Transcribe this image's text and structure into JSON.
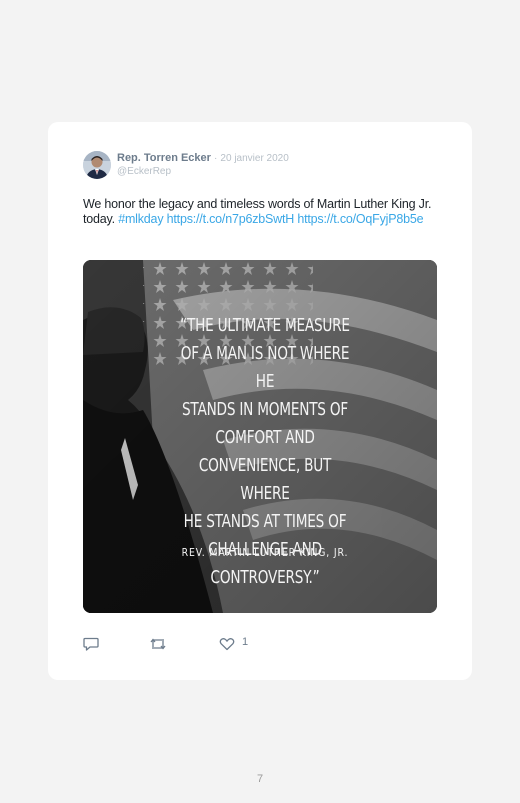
{
  "tweet": {
    "author_name": "Rep. Torren Ecker",
    "separator": "·",
    "date": "20 janvier 2020",
    "handle": "@EckerRep",
    "text_plain": "We honor the legacy and timeless words of Martin Luther King Jr. today.",
    "hashtag": "#mlkday",
    "link1": "https://t.co/n7p6zbSwtH",
    "link2": "https://t.co/OqFyjP8b5e",
    "image": {
      "quote_lines": [
        "“THE ULTIMATE MEASURE",
        "OF A MAN IS NOT WHERE HE",
        "STANDS IN MOMENTS OF",
        "COMFORT AND",
        "CONVENIENCE, BUT WHERE",
        "HE STANDS AT TIMES OF",
        "CHALLENGE AND",
        "CONTROVERSY.”"
      ],
      "attribution": "REV. MARTIN LUTHER KING, JR."
    },
    "actions": {
      "reply_icon": "reply-icon",
      "retweet_icon": "retweet-icon",
      "like_icon": "heart-icon",
      "like_count": "1"
    }
  },
  "page_number": "7",
  "colors": {
    "page_bg": "#f3f3f3",
    "card_bg": "#ffffff",
    "link": "#3aa7e6",
    "muted": "#b8c0c8",
    "author": "#6d7c8c"
  }
}
